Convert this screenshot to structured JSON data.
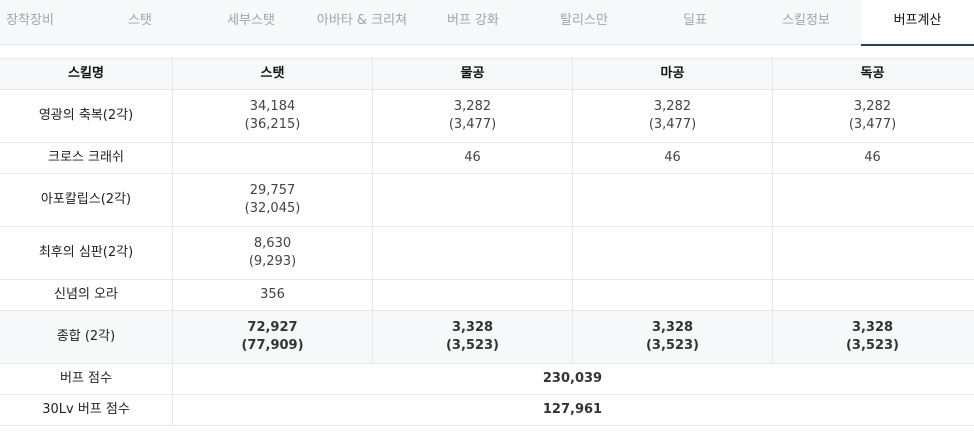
{
  "tabs": [
    "장착장비",
    "스탯",
    "세부스탯",
    "아바타 & 크리쳐",
    "버프 강화",
    "탈리스만",
    "딜표",
    "스킬정보",
    "버프계산"
  ],
  "active_tab": "버프계산",
  "table": {
    "headers": [
      "스킬명",
      "스탯",
      "물공",
      "마공",
      "독공"
    ],
    "rows": [
      {
        "name": "영광의 축복(2각)",
        "values": [
          [
            "34,184",
            "(36,215)"
          ],
          [
            "3,282",
            "(3,477)"
          ],
          [
            "3,282",
            "(3,477)"
          ],
          [
            "3,282",
            "(3,477)"
          ]
        ]
      },
      {
        "name": "크로스 크래쉬",
        "values": [
          [
            ""
          ],
          [
            "46"
          ],
          [
            "46"
          ],
          [
            "46"
          ]
        ]
      },
      {
        "name": "아포칼립스(2각)",
        "values": [
          [
            "29,757",
            "(32,045)"
          ],
          [
            ""
          ],
          [
            ""
          ],
          [
            ""
          ]
        ]
      },
      {
        "name": "최후의 심판(2각)",
        "values": [
          [
            "8,630",
            "(9,293)"
          ],
          [
            ""
          ],
          [
            ""
          ],
          [
            ""
          ]
        ]
      },
      {
        "name": "신념의 오라",
        "values": [
          [
            "356"
          ],
          [
            ""
          ],
          [
            ""
          ],
          [
            ""
          ]
        ]
      }
    ],
    "total": {
      "name": "종합 (2각)",
      "values": [
        [
          "72,927",
          "(77,909)"
        ],
        [
          "3,328",
          "(3,523)"
        ],
        [
          "3,328",
          "(3,523)"
        ],
        [
          "3,328",
          "(3,523)"
        ]
      ]
    },
    "buff_score": {
      "label": "버프 점수",
      "value": "230,039"
    },
    "buff_score_30lv": {
      "label": "30Lv 버프 점수",
      "value": "127,961"
    }
  }
}
